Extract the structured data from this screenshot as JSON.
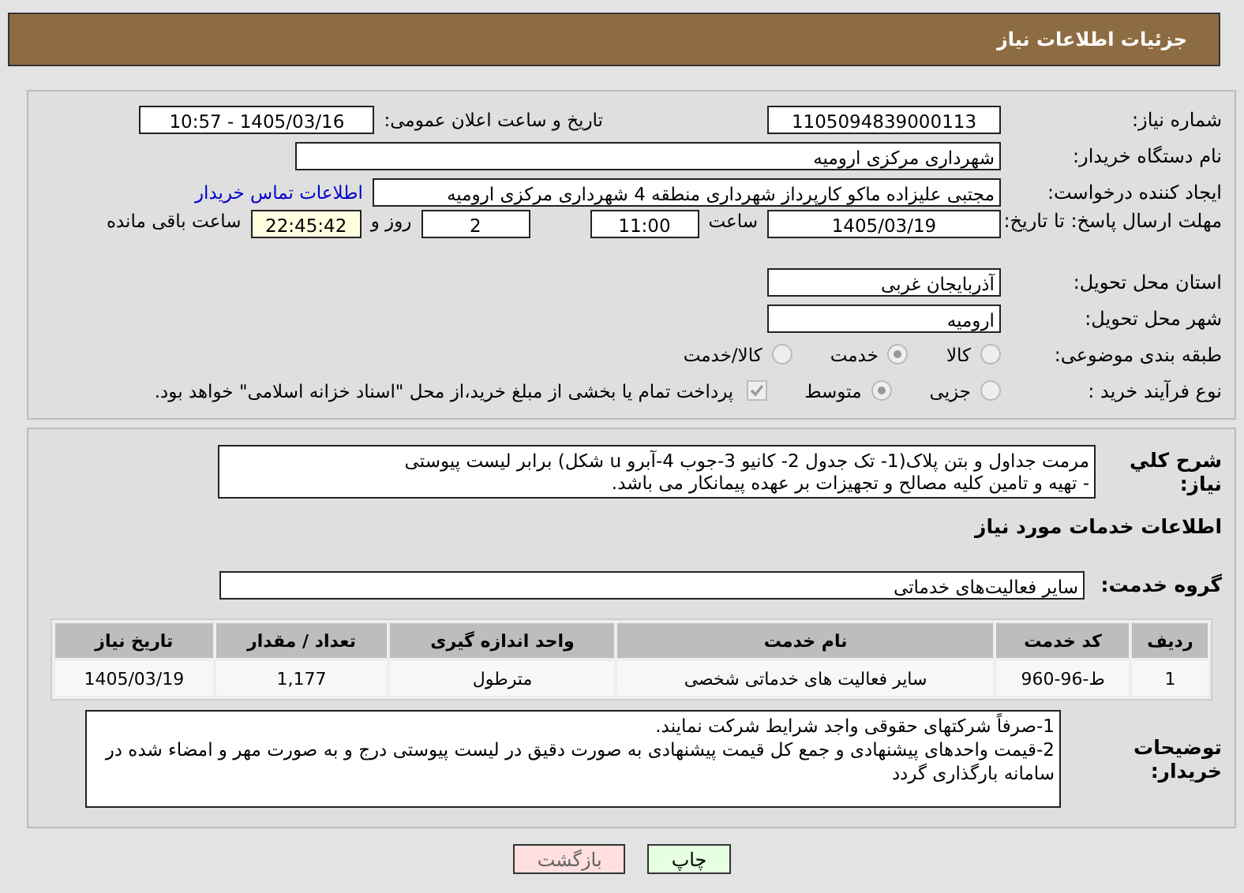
{
  "header": {
    "title": "جزئیات اطلاعات نیاز"
  },
  "need_number": {
    "label": "شماره نیاز:",
    "value": "1105094839000113"
  },
  "announce": {
    "label": "تاریخ و ساعت اعلان عمومی:",
    "value": "1405/03/16 - 10:57"
  },
  "buyer_org": {
    "label": "نام دستگاه خریدار:",
    "value": "شهرداری مرکزی ارومیه"
  },
  "requester": {
    "label": "ایجاد کننده درخواست:",
    "value": "مجتبی علیزاده ماکو کارپرداز شهرداری منطقه 4 شهرداری مرکزی ارومیه",
    "link": "اطلاعات تماس خریدار"
  },
  "deadline": {
    "label": "مهلت ارسال پاسخ: تا تاریخ:",
    "date": "1405/03/19",
    "time_label": "ساعت",
    "time": "11:00",
    "days": "2",
    "days_label": "روز و",
    "remaining": "22:45:42",
    "remaining_label": "ساعت باقی مانده"
  },
  "province": {
    "label": "استان محل تحویل:",
    "value": "آذربایجان غربی"
  },
  "city": {
    "label": "شهر محل تحویل:",
    "value": "ارومیه"
  },
  "category": {
    "label": "طبقه بندی موضوعی:",
    "options": [
      {
        "label": "کالا",
        "selected": false
      },
      {
        "label": "خدمت",
        "selected": true
      },
      {
        "label": "کالا/خدمت",
        "selected": false
      }
    ]
  },
  "process": {
    "label": "نوع فرآیند خرید :",
    "options": [
      {
        "label": "جزیی",
        "selected": false
      },
      {
        "label": "متوسط",
        "selected": true
      }
    ],
    "payment": {
      "checked": true,
      "label": "پرداخت تمام یا بخشی از مبلغ خرید،از محل \"اسناد خزانه اسلامی\" خواهد بود."
    }
  },
  "description": {
    "label": "شرح کلي نياز:",
    "text": "مرمت جداول و بتن پلاک(1- تک جدول 2- کانیو 3-جوب 4-آبرو u شکل) برابر لیست پیوستی\n- تهیه و تامین کلیه مصالح و تجهیزات بر عهده پیمانکار می باشد."
  },
  "services_heading": "اطلاعات خدمات مورد نیاز",
  "service_group": {
    "label": "گروه خدمت:",
    "value": "سایر فعالیت‌های خدماتی"
  },
  "table": {
    "columns": [
      "ردیف",
      "کد خدمت",
      "نام خدمت",
      "واحد اندازه گیری",
      "تعداد / مقدار",
      "تاریخ نیاز"
    ],
    "rows": [
      [
        "1",
        "ط-96-960",
        "سایر فعالیت های خدماتی شخصی",
        "مترطول",
        "1,177",
        "1405/03/19"
      ]
    ]
  },
  "buyer_notes": {
    "label": "توضیحات خریدار:",
    "text": "1-صرفاً شرکتهای حقوقی واجد شرایط شرکت نمایند.\n2-قیمت واحدهای پیشنهادی و جمع کل قیمت پیشنهادی به صورت دقیق در لیست پیوستی درج و به صورت مهر و امضاء شده در سامانه بارگذاری گردد"
  },
  "buttons": [
    {
      "label": "چاپ",
      "kind": "print"
    },
    {
      "label": "بازگشت",
      "kind": "back"
    }
  ]
}
